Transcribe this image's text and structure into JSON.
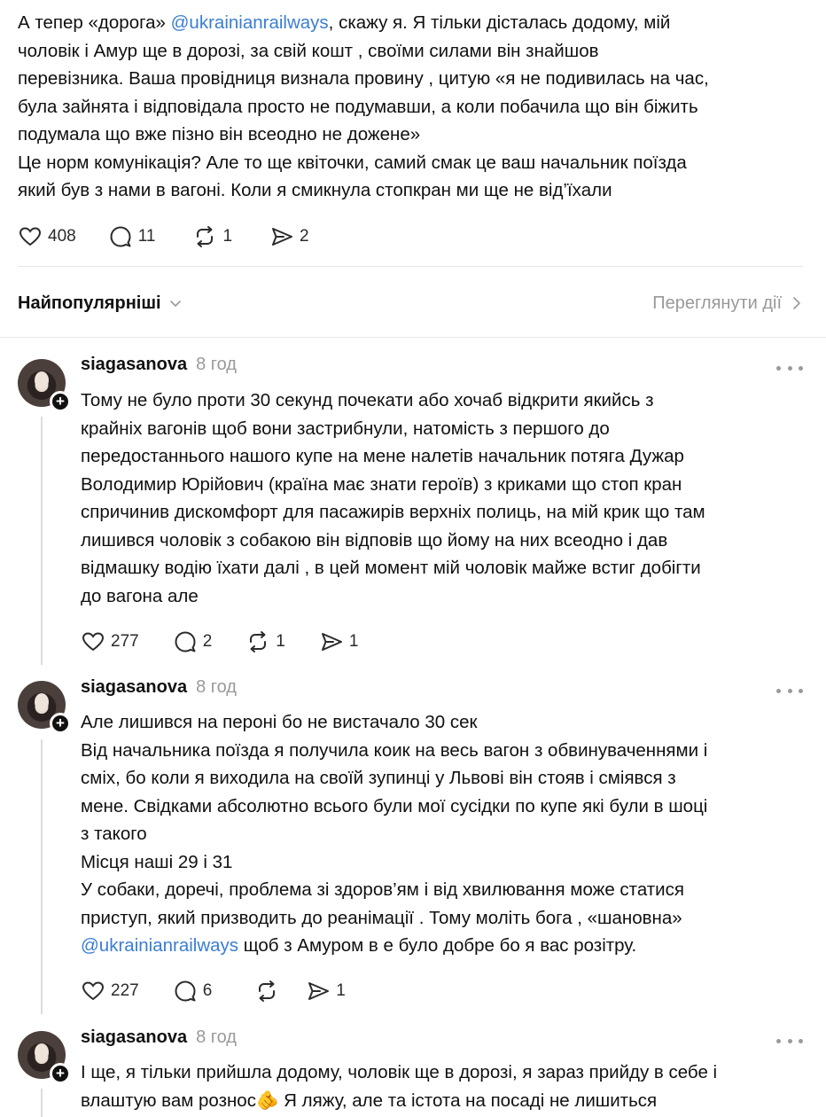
{
  "post": {
    "lines": [
      {
        "pre": "А тепер «дорога» ",
        "mention": "@ukrainianrailways",
        "post": ", скажу я. Я тільки дісталась додому, мій"
      },
      {
        "pre": "чоловік і Амур ще в дорозі, за свій кошт , своїми силами він знайшов",
        "mention": "",
        "post": ""
      },
      {
        "pre": "перевізника. Ваша провідниця визнала провину , цитую «я не подивилась на час,",
        "mention": "",
        "post": ""
      },
      {
        "pre": "була зайнята і відповідала просто не подумавши, а коли побачила що він біжить",
        "mention": "",
        "post": ""
      },
      {
        "pre": "подумала що вже пізно він всеодно не дожене»",
        "mention": "",
        "post": ""
      },
      {
        "pre": "Це норм комунікація? Але то ще квіточки, самий смак це ваш начальник поїзда",
        "mention": "",
        "post": ""
      },
      {
        "pre": "який був з нами в вагоні. Коли я смикнула стопкран ми ще не від’їхали",
        "mention": "",
        "post": ""
      }
    ],
    "likes": "408",
    "comments": "11",
    "reposts": "1",
    "shares": "2"
  },
  "sort": {
    "label": "Найпопулярніші",
    "view_activity": "Переглянути дії"
  },
  "replies": [
    {
      "username": "siagasanova",
      "time": "8 год",
      "lines": [
        {
          "pre": "Тому не було проти 30 секунд почекати або хочаб відкрити якийсь з",
          "mention": "",
          "post": ""
        },
        {
          "pre": "крайніх вагонів щоб вони застрибнули, натомість з першого до",
          "mention": "",
          "post": ""
        },
        {
          "pre": "передостаннього нашого купе на мене налетів начальник потяга Дужар",
          "mention": "",
          "post": ""
        },
        {
          "pre": "Володимир Юрійович (країна має знати героїв) з криками що стоп кран",
          "mention": "",
          "post": ""
        },
        {
          "pre": "спричинив дискомфорт для пасажирів верхніх полиць, на мій крик що там",
          "mention": "",
          "post": ""
        },
        {
          "pre": "лишився чоловік з собакою він відповів що йому на них всеодно і дав",
          "mention": "",
          "post": ""
        },
        {
          "pre": "відмашку водію їхати далі , в цей момент мій чоловік майже встиг добігти",
          "mention": "",
          "post": ""
        },
        {
          "pre": "до вагона але",
          "mention": "",
          "post": ""
        }
      ],
      "likes": "277",
      "comments": "2",
      "reposts": "1",
      "shares": "1"
    },
    {
      "username": "siagasanova",
      "time": "8 год",
      "lines": [
        {
          "pre": "Але лишився на пероні бо не вистачало 30 сек",
          "mention": "",
          "post": ""
        },
        {
          "pre": "Від начальника поїзда я получила коик на весь вагон з обвинуваченнями і",
          "mention": "",
          "post": ""
        },
        {
          "pre": "сміх, бо коли я виходила на своїй зупинці у Львові він стояв і сміявся з",
          "mention": "",
          "post": ""
        },
        {
          "pre": "мене. Свідками абсолютно всього були мої сусідки по купе які були в шоці",
          "mention": "",
          "post": ""
        },
        {
          "pre": "з такого",
          "mention": "",
          "post": ""
        },
        {
          "pre": "Місця наші 29 і 31",
          "mention": "",
          "post": ""
        },
        {
          "pre": "У собаки, доречі, проблема зі здоров’ям і від хвилювання може статися",
          "mention": "",
          "post": ""
        },
        {
          "pre": "приступ, який призводить до реанімації . Тому моліть бога , «шановна»",
          "mention": "",
          "post": ""
        },
        {
          "pre": "",
          "mention": "@ukrainianrailways",
          "post": " щоб з Амуром в е було добре бо я вас розітру."
        }
      ],
      "likes": "227",
      "comments": "6",
      "reposts": "",
      "shares": "1"
    },
    {
      "username": "siagasanova",
      "time": "8 год",
      "lines": [
        {
          "pre": "І ще, я тільки прийшла додому, чоловік ще в дорозі, я зараз прийду в себе і",
          "mention": "",
          "post": ""
        },
        {
          "pre": "влаштую вам рознос🫵 Я ляжу, але та істота на посаді не лишиться",
          "mention": "",
          "post": ""
        }
      ]
    }
  ]
}
